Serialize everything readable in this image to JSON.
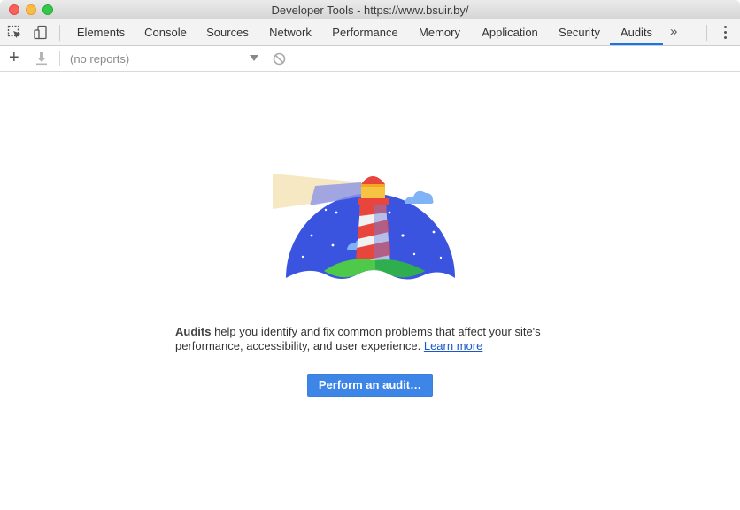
{
  "window": {
    "title": "Developer Tools - https://www.bsuir.by/"
  },
  "tabs": [
    {
      "label": "Elements",
      "active": false
    },
    {
      "label": "Console",
      "active": false
    },
    {
      "label": "Sources",
      "active": false
    },
    {
      "label": "Network",
      "active": false
    },
    {
      "label": "Performance",
      "active": false
    },
    {
      "label": "Memory",
      "active": false
    },
    {
      "label": "Application",
      "active": false
    },
    {
      "label": "Security",
      "active": false
    },
    {
      "label": "Audits",
      "active": true
    }
  ],
  "tab_overflow_label": "»",
  "toolbar": {
    "reports_value": "(no reports)"
  },
  "main": {
    "description_strong": "Audits",
    "description_text": " help you identify and fix common problems that affect your site's performance, accessibility, and user experience. ",
    "learn_more_label": "Learn more",
    "perform_button_label": "Perform an audit…"
  },
  "colors": {
    "accent": "#1a73e8",
    "button": "#3d86e8",
    "sky": "#3a54e0",
    "grass": "#4ec94a"
  }
}
